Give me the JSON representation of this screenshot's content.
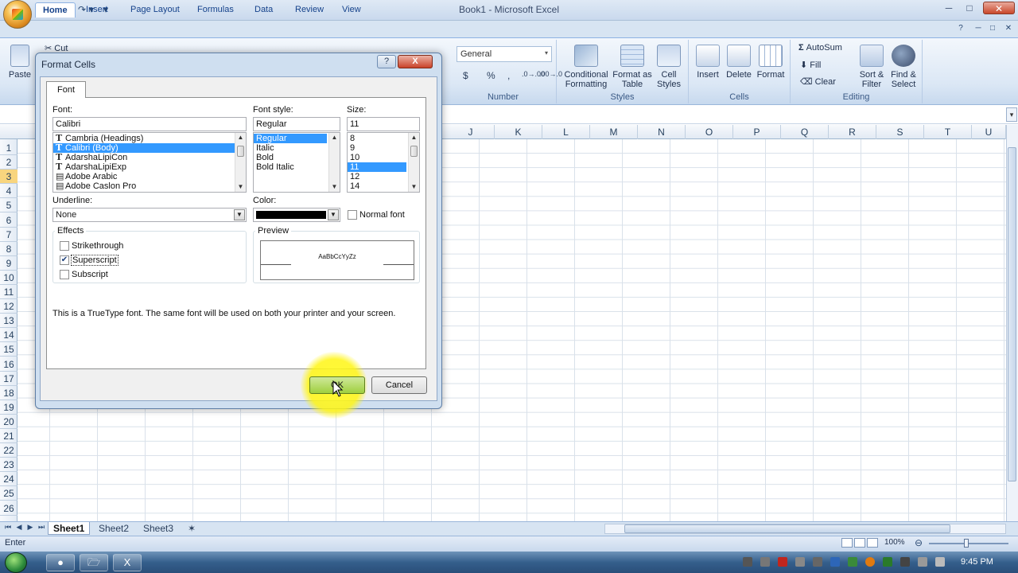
{
  "window": {
    "title": "Book1 - Microsoft Excel"
  },
  "ribbon": {
    "tabs": [
      "Home",
      "Insert",
      "Page Layout",
      "Formulas",
      "Data",
      "Review",
      "View"
    ],
    "clipboard": {
      "paste": "Paste",
      "cut": "Cut"
    },
    "number": {
      "format_value": "General",
      "dollar": "$",
      "percent": "%",
      "comma": ",",
      "group_label": "Number"
    },
    "styles": {
      "conditional": "Conditional Formatting",
      "format_table": "Format as Table",
      "cell_styles": "Cell Styles",
      "group_label": "Styles"
    },
    "cells": {
      "insert": "Insert",
      "delete": "Delete",
      "format": "Format",
      "group_label": "Cells"
    },
    "editing": {
      "autosum": "AutoSum",
      "fill": "Fill",
      "clear": "Clear",
      "sort_filter": "Sort & Filter",
      "find_select": "Find & Select",
      "group_label": "Editing"
    }
  },
  "grid": {
    "columns": [
      "J",
      "K",
      "L",
      "M",
      "N",
      "O",
      "P",
      "Q",
      "R",
      "S",
      "T",
      "U"
    ],
    "rows": [
      "1",
      "2",
      "3",
      "4",
      "5",
      "6",
      "7",
      "8",
      "9",
      "10",
      "11",
      "12",
      "13",
      "14",
      "15",
      "16",
      "17",
      "18",
      "19",
      "20",
      "21",
      "22",
      "23",
      "24",
      "25",
      "26"
    ],
    "selected_row": "3"
  },
  "sheets": {
    "tabs": [
      "Sheet1",
      "Sheet2",
      "Sheet3"
    ],
    "active": "Sheet1"
  },
  "status": {
    "mode": "Enter",
    "zoom": "100%"
  },
  "taskbar": {
    "clock": "9:45 PM"
  },
  "dialog": {
    "title": "Format Cells",
    "help": "?",
    "close": "X",
    "tab": "Font",
    "font_label": "Font:",
    "font_value": "Calibri",
    "font_list": [
      "Cambria (Headings)",
      "Calibri (Body)",
      "AdarshaLipiCon",
      "AdarshaLipiExp",
      "Adobe Arabic",
      "Adobe Caslon Pro"
    ],
    "font_selected_index": 1,
    "style_label": "Font style:",
    "style_value": "Regular",
    "style_list": [
      "Regular",
      "Italic",
      "Bold",
      "Bold Italic"
    ],
    "size_label": "Size:",
    "size_value": "11",
    "size_list": [
      "8",
      "9",
      "10",
      "11",
      "12",
      "14"
    ],
    "underline_label": "Underline:",
    "underline_value": "None",
    "color_label": "Color:",
    "color_value": "#000000",
    "normal_font_label": "Normal font",
    "effects_label": "Effects",
    "strikethrough_label": "Strikethrough",
    "superscript_label": "Superscript",
    "subscript_label": "Subscript",
    "superscript_checked": true,
    "preview_label": "Preview",
    "preview_text": "AaBbCcYyZz",
    "info_text": "This is a TrueType font.  The same font will be used on both your printer and your screen.",
    "ok_label": "OK",
    "cancel_label": "Cancel"
  }
}
